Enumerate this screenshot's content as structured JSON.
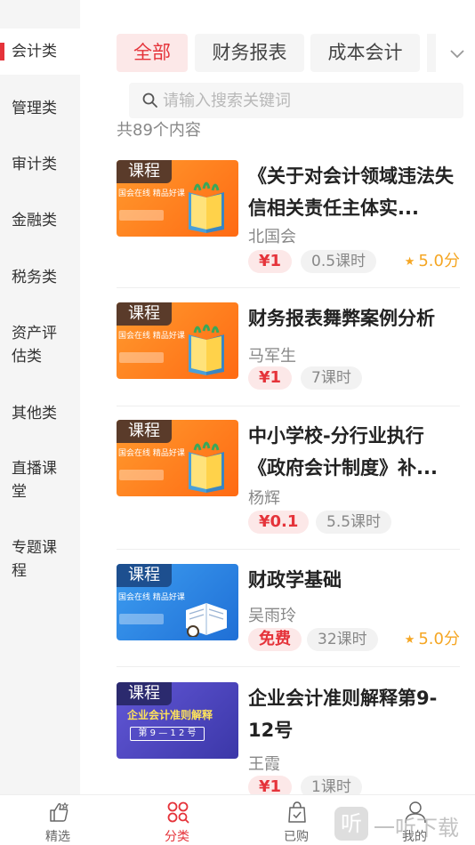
{
  "sidebar": {
    "items": [
      {
        "label": "会计类",
        "active": true
      },
      {
        "label": "管理类"
      },
      {
        "label": "审计类"
      },
      {
        "label": "金融类"
      },
      {
        "label": "税务类"
      },
      {
        "label": "资产评估类"
      },
      {
        "label": "其他类"
      },
      {
        "label": "直播课堂"
      },
      {
        "label": "专题课程"
      }
    ]
  },
  "tabs": [
    {
      "label": "全部",
      "active": true
    },
    {
      "label": "财务报表"
    },
    {
      "label": "成本会计"
    }
  ],
  "search": {
    "placeholder": "请输入搜索关键词"
  },
  "count_text": "共89个内容",
  "courses": [
    {
      "badge": "课程",
      "title": "《关于对会计领域违法失信相关责任主体实...",
      "author": "北国会",
      "price": "¥1",
      "hours": "0.5课时",
      "rating": "5.0分",
      "thumb_slogan": "国会在线 精品好课"
    },
    {
      "badge": "课程",
      "title": "财务报表舞弊案例分析",
      "author": "马军生",
      "price": "¥1",
      "hours": "7课时",
      "thumb_slogan": "国会在线 精品好课"
    },
    {
      "badge": "课程",
      "title": "中小学校-分行业执行《政府会计制度》补...",
      "author": "杨辉",
      "price": "¥0.1",
      "hours": "5.5课时",
      "thumb_slogan": "国会在线 精品好课"
    },
    {
      "badge": "课程",
      "title": "财政学基础",
      "author": "吴雨玲",
      "price": "免费",
      "hours": "32课时",
      "rating": "5.0分",
      "thumb_slogan": "国会在线 精品好课"
    },
    {
      "badge": "课程",
      "title": "企业会计准则解释第9-12号",
      "author": "王霞",
      "price": "¥1",
      "hours": "1课时",
      "thumb_title": "企业会计准则解释",
      "thumb_sub": "第 9 — 1 2 号"
    }
  ],
  "bottom_nav": [
    {
      "label": "精选",
      "icon": "thumbs-up-icon"
    },
    {
      "label": "分类",
      "icon": "category-grid-icon",
      "active": true
    },
    {
      "label": "已购",
      "icon": "bag-check-icon"
    },
    {
      "label": "我的",
      "icon": "user-icon"
    }
  ],
  "watermark": {
    "logo": "听",
    "text": "一听下载"
  },
  "colors": {
    "accent": "#e5333a",
    "rating": "#f5a623"
  }
}
